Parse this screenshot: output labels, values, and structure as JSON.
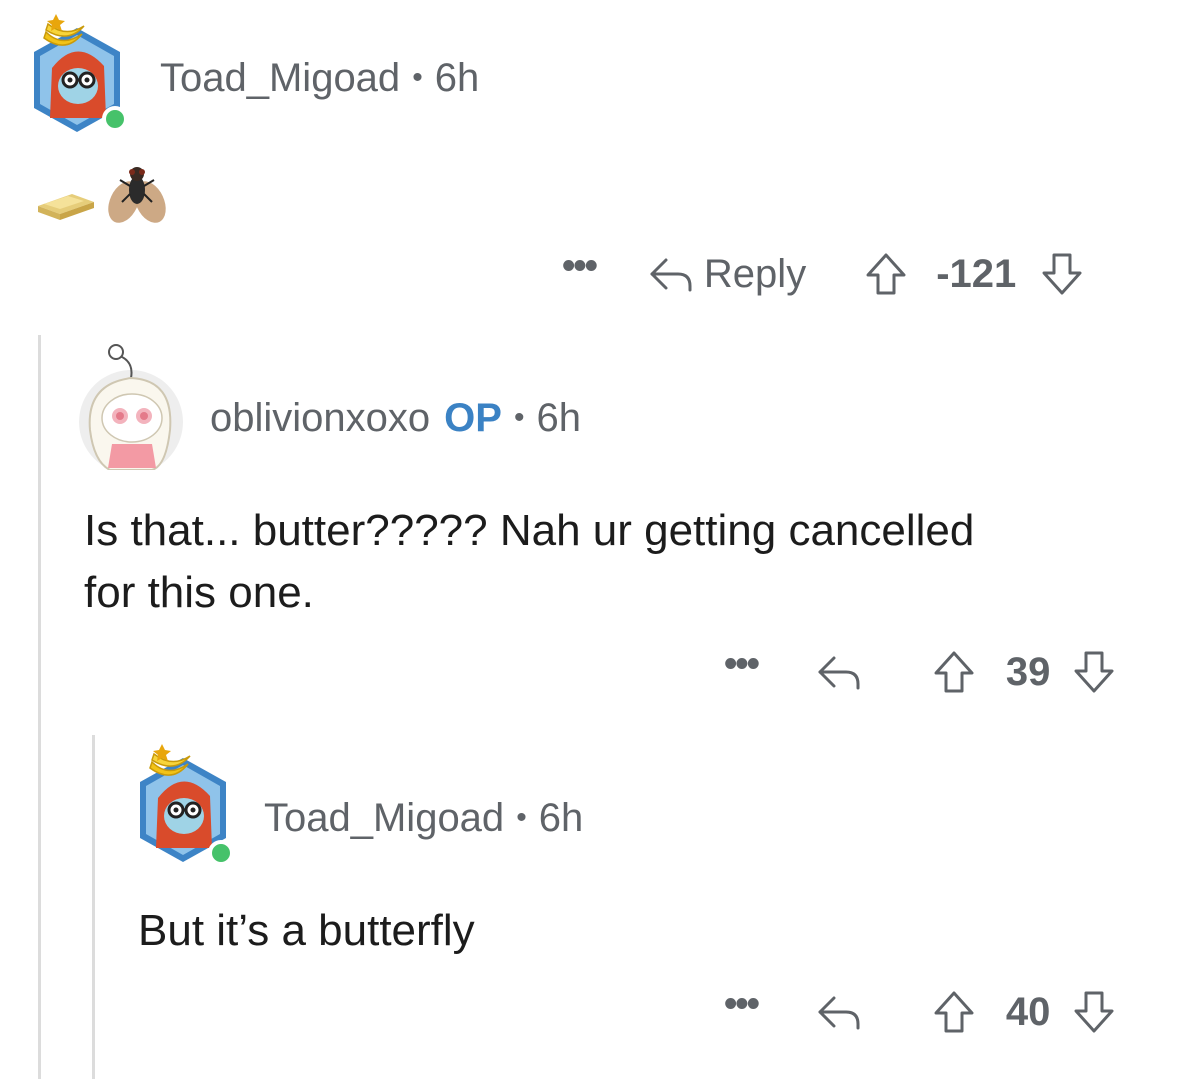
{
  "comments": [
    {
      "author": "Toad_Migoad",
      "time": "6h",
      "separator": "•",
      "body_emoji": [
        "butter-icon",
        "fly-icon"
      ],
      "more": "•••",
      "reply_label": "Reply",
      "score": "-121"
    },
    {
      "author": "oblivionxoxo",
      "op_badge": "OP",
      "time": "6h",
      "separator": "•",
      "body_lines": [
        "Is that... butter????? Nah ur getting cancelled",
        "for this one."
      ],
      "more": "•••",
      "score": "39"
    },
    {
      "author": "Toad_Migoad",
      "time": "6h",
      "separator": "•",
      "body_lines": [
        "But it’s a butterfly"
      ],
      "more": "•••",
      "score": "40"
    }
  ],
  "colors": {
    "meta_text": "#5f6368",
    "op_badge": "#3b82c4",
    "online": "#46c26a",
    "thread_line": "#dcdcdc"
  }
}
